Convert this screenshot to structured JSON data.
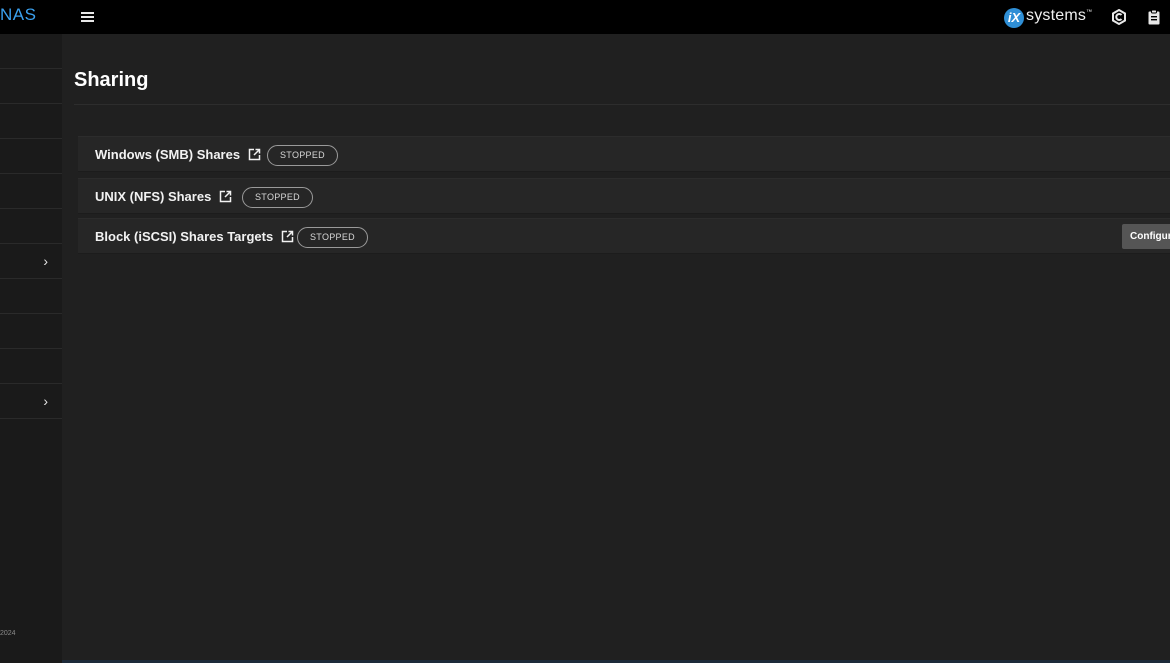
{
  "app": {
    "logo_text": "NAS",
    "brand": {
      "badge": "iX",
      "word": "systems"
    },
    "accent_color": "#3ba1ef"
  },
  "topbar": {
    "icons": [
      "menu-icon",
      "truecommand-icon",
      "clipboard-icon"
    ]
  },
  "sidebar": {
    "footer_text": "2024",
    "expandable_rows": [
      "chevron-right-icon",
      "chevron-right-icon"
    ]
  },
  "main": {
    "title": "Sharing",
    "shares": [
      {
        "label": "Windows (SMB) Shares",
        "status": "STOPPED",
        "icon": "open-in-new-icon"
      },
      {
        "label": "UNIX (NFS) Shares",
        "status": "STOPPED",
        "icon": "open-in-new-icon"
      },
      {
        "label": "Block (iSCSI) Shares Targets",
        "status": "STOPPED",
        "icon": "open-in-new-icon",
        "action": "Configure"
      }
    ]
  }
}
